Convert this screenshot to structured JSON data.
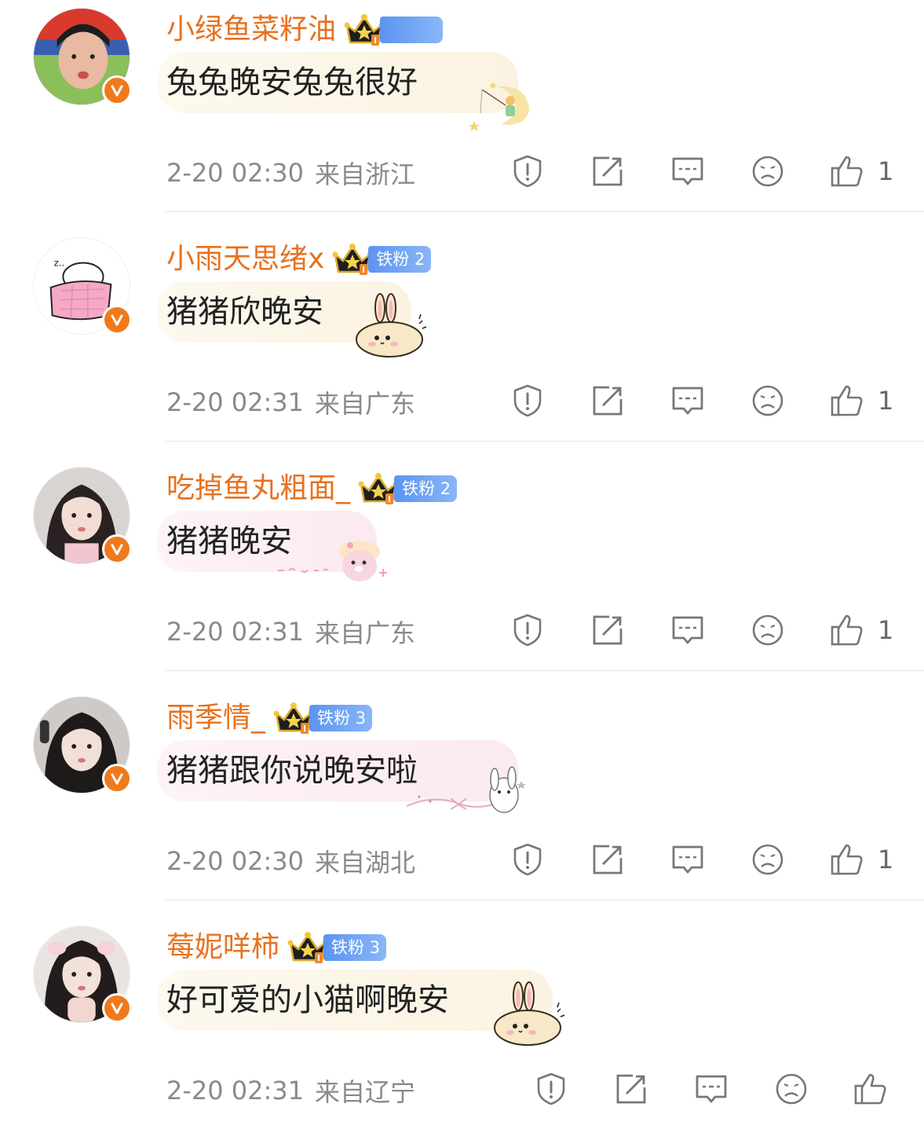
{
  "comments": [
    {
      "username": "小绿鱼菜籽油",
      "fan_badge": "",
      "text": "兔兔晚安兔兔很好",
      "time": "2-20 02:30",
      "location": "来自浙江",
      "likes": "1",
      "avatar_icon": "user-photo-avatar",
      "sticker": "prince-moon-sticker"
    },
    {
      "username": "小雨天思绪x",
      "fan_badge": "铁粉 2",
      "text": "猪猪欣晚安",
      "time": "2-20 02:31",
      "location": "来自广东",
      "likes": "1",
      "avatar_icon": "sleeping-blanket-avatar",
      "sticker": "bunny-sticker"
    },
    {
      "username": "吃掉鱼丸粗面_",
      "fan_badge": "铁粉 2",
      "text": "猪猪晚安",
      "time": "2-20 02:31",
      "location": "来自广东",
      "likes": "1",
      "avatar_icon": "user-photo-avatar",
      "sticker": "pink-bear-sticker"
    },
    {
      "username": "雨季情_",
      "fan_badge": "铁粉 3",
      "text": "猪猪跟你说晚安啦",
      "time": "2-20 02:30",
      "location": "来自湖北",
      "likes": "1",
      "avatar_icon": "user-photo-avatar",
      "sticker": "white-bunny-ribbon-sticker"
    },
    {
      "username": "莓妮咩柿",
      "fan_badge": "铁粉 3",
      "text": "好可爱的小猫啊晚安",
      "time": "2-20 02:31",
      "location": "来自辽宁",
      "likes": "",
      "avatar_icon": "user-photo-avatar",
      "sticker": "bunny-sticker"
    }
  ],
  "colors": {
    "username": "#e8711f",
    "badge_blue": "#5b94f1",
    "verified_orange": "#f07a1b",
    "meta_gray": "#8a8a8a"
  },
  "icons": [
    "report-icon",
    "repost-icon",
    "reply-icon",
    "dislike-icon",
    "like-icon",
    "crown-icon",
    "verified-icon"
  ]
}
